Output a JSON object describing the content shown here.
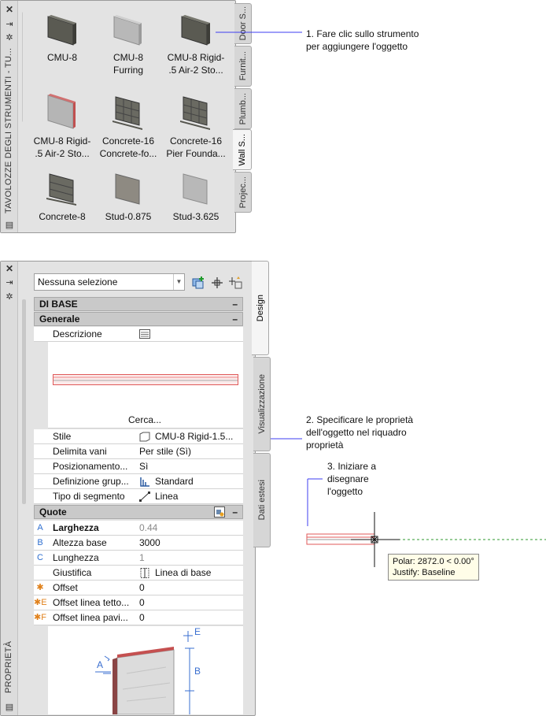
{
  "palette": {
    "title": "TAVOLOZZE DEGLI STRUMENTI - TU...",
    "tools": [
      {
        "label": "CMU-8",
        "style": "dark"
      },
      {
        "label": "CMU-8\nFurring",
        "style": "light"
      },
      {
        "label": "CMU-8 Rigid-\n.5 Air-2 Sto...",
        "style": "dark"
      },
      {
        "label": "CMU-8 Rigid-\n.5 Air-2 Sto...",
        "style": "light-red"
      },
      {
        "label": "Concrete-16\nConcrete-fo...",
        "style": "block"
      },
      {
        "label": "Concrete-16\nPier Founda...",
        "style": "block"
      },
      {
        "label": "Concrete-8",
        "style": "block"
      },
      {
        "label": "Stud-0.875",
        "style": "mid"
      },
      {
        "label": "Stud-3.625",
        "style": "light"
      }
    ],
    "tabs": [
      "Door S...",
      "Furnit...",
      "Plumb...",
      "Wall S...",
      "Projec..."
    ],
    "active_tab": "Wall S..."
  },
  "properties": {
    "title": "PROPRIETÀ",
    "selection": "Nessuna selezione",
    "categories": {
      "di_base": "DI BASE",
      "generale": "Generale",
      "quote": "Quote"
    },
    "descrizione": "Descrizione",
    "cerca": "Cerca...",
    "rows_generale": [
      {
        "label": "Stile",
        "value": "CMU-8 Rigid-1.5..."
      },
      {
        "label": "Delimita vani",
        "value": "Per stile (Sì)"
      },
      {
        "label": "Posizionamento...",
        "value": "Sì"
      },
      {
        "label": "Definizione grup...",
        "value": "Standard"
      },
      {
        "label": "Tipo di segmento",
        "value": "Linea"
      }
    ],
    "rows_quote": [
      {
        "marker": "A",
        "label": "Larghezza",
        "value": "0.44"
      },
      {
        "marker": "B",
        "label": "Altezza base",
        "value": "3000"
      },
      {
        "marker": "C",
        "label": "Lunghezza",
        "value": "1"
      },
      {
        "marker": "",
        "label": "Giustifica",
        "value": "Linea di base"
      },
      {
        "marker": "✱",
        "label": "Offset",
        "value": "0"
      },
      {
        "marker": "✱E",
        "label": "Offset linea tetto...",
        "value": "0"
      },
      {
        "marker": "✱F",
        "label": "Offset linea pavi...",
        "value": "0"
      }
    ],
    "diagram_labels": {
      "a": "A",
      "b": "B",
      "e": "E"
    },
    "tabs": [
      "Design",
      "Visualizzazione",
      "Dati estesi"
    ],
    "active_tab": "Design"
  },
  "callouts": {
    "step1": "1. Fare clic sullo strumento\nper aggiungere l'oggetto",
    "step2": "2. Specificare le proprietà\ndell'oggetto nel riquadro\nproprietà",
    "step3": "3. Iniziare a\ndisegnare\nl'oggetto"
  },
  "tooltip": {
    "line1": "Polar: 2872.0 < 0.00°",
    "line2": "Justify: Baseline"
  },
  "colors": {
    "panel_bg": "#e3e3e3",
    "callout_line": "#3d3df0",
    "wall_red": "#e05a5a",
    "guide_green": "#2e9a2e"
  },
  "icons": [
    "close-icon",
    "pin-icon",
    "gear-icon",
    "palette-menu-icon",
    "quick-select-icon",
    "pick-point-icon",
    "select-objects-icon",
    "description-icon",
    "style-icon",
    "group-definition-icon",
    "segment-line-icon",
    "justify-icon"
  ]
}
